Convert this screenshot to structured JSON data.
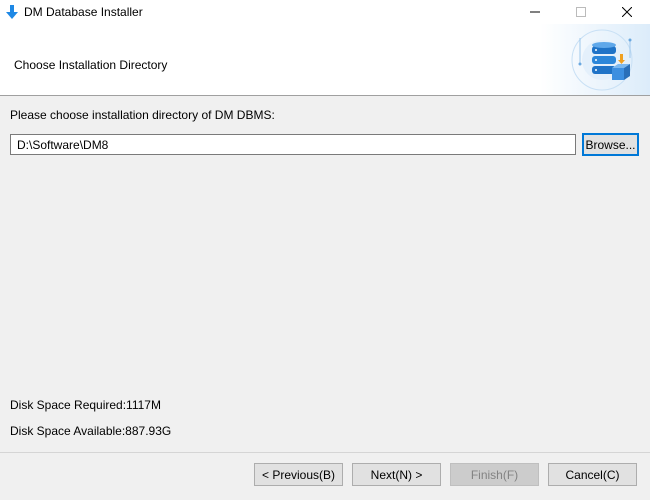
{
  "window": {
    "title": "DM Database Installer",
    "controls": {
      "minimize": "minimize-icon",
      "maximize": "maximize-icon",
      "close": "close-icon"
    }
  },
  "header": {
    "title": "Choose Installation Directory",
    "art_icon": "database-illustration"
  },
  "content": {
    "prompt": "Please choose installation directory of DM DBMS:",
    "path_value": "D:\\Software\\DM8",
    "browse_label": "Browse...",
    "disk_required": "Disk Space Required:1117M",
    "disk_available": "Disk Space Available:887.93G"
  },
  "footer": {
    "previous_label": "< Previous(B)",
    "next_label": "Next(N) >",
    "finish_label": "Finish(F)",
    "cancel_label": "Cancel(C)",
    "finish_enabled": false
  },
  "colors": {
    "accent": "#0078d7",
    "window_bg": "#f0f0f0",
    "db_blue": "#1f73c7",
    "db_orange": "#f0a020"
  }
}
